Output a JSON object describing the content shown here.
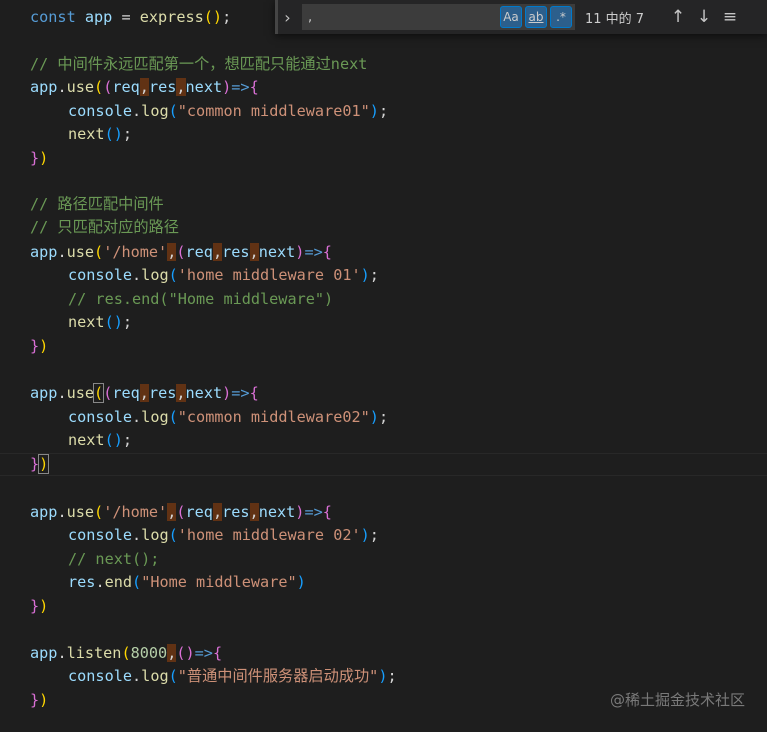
{
  "find": {
    "query": ",",
    "match_case_label": "Aa",
    "whole_word_label": "ab",
    "regex_label": ".*",
    "count": "11 中的 7",
    "expand_glyph": "›",
    "prev_glyph": "↑",
    "next_glyph": "↓",
    "menu_glyph": "≡"
  },
  "code": {
    "l1": {
      "kw": "const",
      "var": "app",
      "eq": " = ",
      "fn": "express",
      "p": "()",
      "end": ";"
    },
    "l3": "// 中间件永远匹配第一个，想匹配只能通过next",
    "app": "app",
    "dot": ".",
    "use": "use",
    "listen": "listen",
    "req": "req",
    "res": "res",
    "next": "next",
    "comma": ",",
    "arrow": "=>",
    "console": "console",
    "log": "log",
    "next_call": "next",
    "end_fn": "end",
    "s_common1": "\"common middleware01\"",
    "s_common2": "\"common middleware02\"",
    "s_home": "'/home'",
    "s_home1": "'home middleware 01'",
    "s_home2": "'home middleware 02'",
    "s_home_mw": "\"Home middleware\"",
    "c_res_end": "// res.end(\"Home middleware\")",
    "c_path1": "// 路径匹配中间件",
    "c_path2": "// 只匹配对应的路径",
    "c_next": "// next();",
    "port": "8000",
    "s_success": "\"普通中间件服务器启动成功\""
  },
  "watermark": "@稀土掘金技术社区",
  "colors": {
    "background": "#1e1e1e",
    "keyword": "#569cd6",
    "variable": "#9cdcfe",
    "function": "#dcdcaa",
    "string": "#ce9178",
    "number": "#b5cea8",
    "comment": "#6a9955",
    "bracket1": "#ffd700",
    "bracket2": "#da70d6",
    "bracket3": "#179fff",
    "match_highlight": "#ea5c00"
  }
}
